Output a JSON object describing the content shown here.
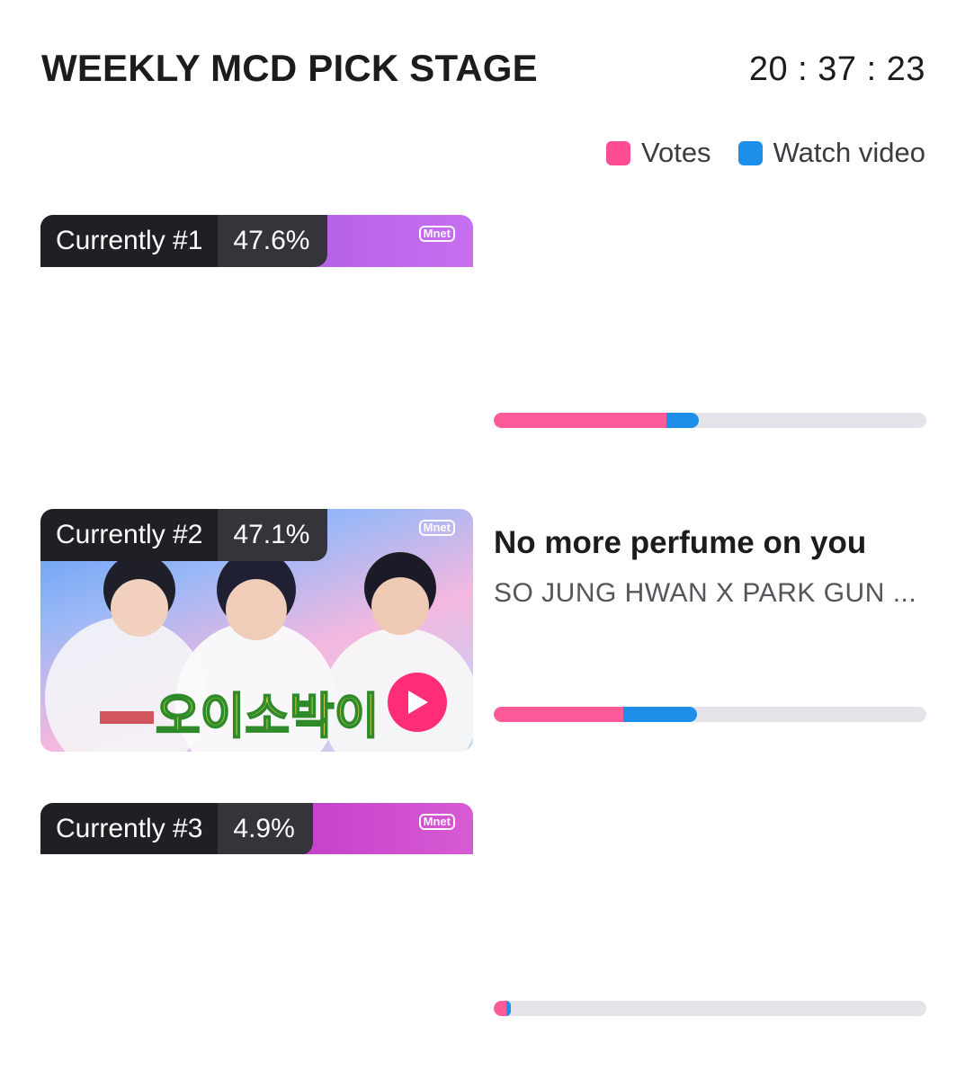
{
  "header": {
    "title": "WEEKLY MCD PICK STAGE",
    "countdown": "20 : 37 : 23"
  },
  "legend": {
    "votes_label": "Votes",
    "watch_label": "Watch video"
  },
  "colors": {
    "votes": "#ff4d94",
    "watch": "#1e8fe8",
    "track": "#e4e3ea"
  },
  "entries": [
    {
      "rank_label": "Currently #1",
      "percent": "47.6%",
      "broadcaster_logo": "Mnet",
      "votes_fraction": 0.4,
      "watch_fraction": 0.075
    },
    {
      "rank_label": "Currently #2",
      "percent": "47.1%",
      "broadcaster_logo": "Mnet",
      "song_title": "No more perfume on you",
      "artist": "SO JUNG HWAN X PARK GUN ...",
      "caption": "오이소박이",
      "votes_fraction": 0.3,
      "watch_fraction": 0.17
    },
    {
      "rank_label": "Currently #3",
      "percent": "4.9%",
      "broadcaster_logo": "Mnet",
      "votes_fraction": 0.03,
      "watch_fraction": 0.01
    }
  ]
}
